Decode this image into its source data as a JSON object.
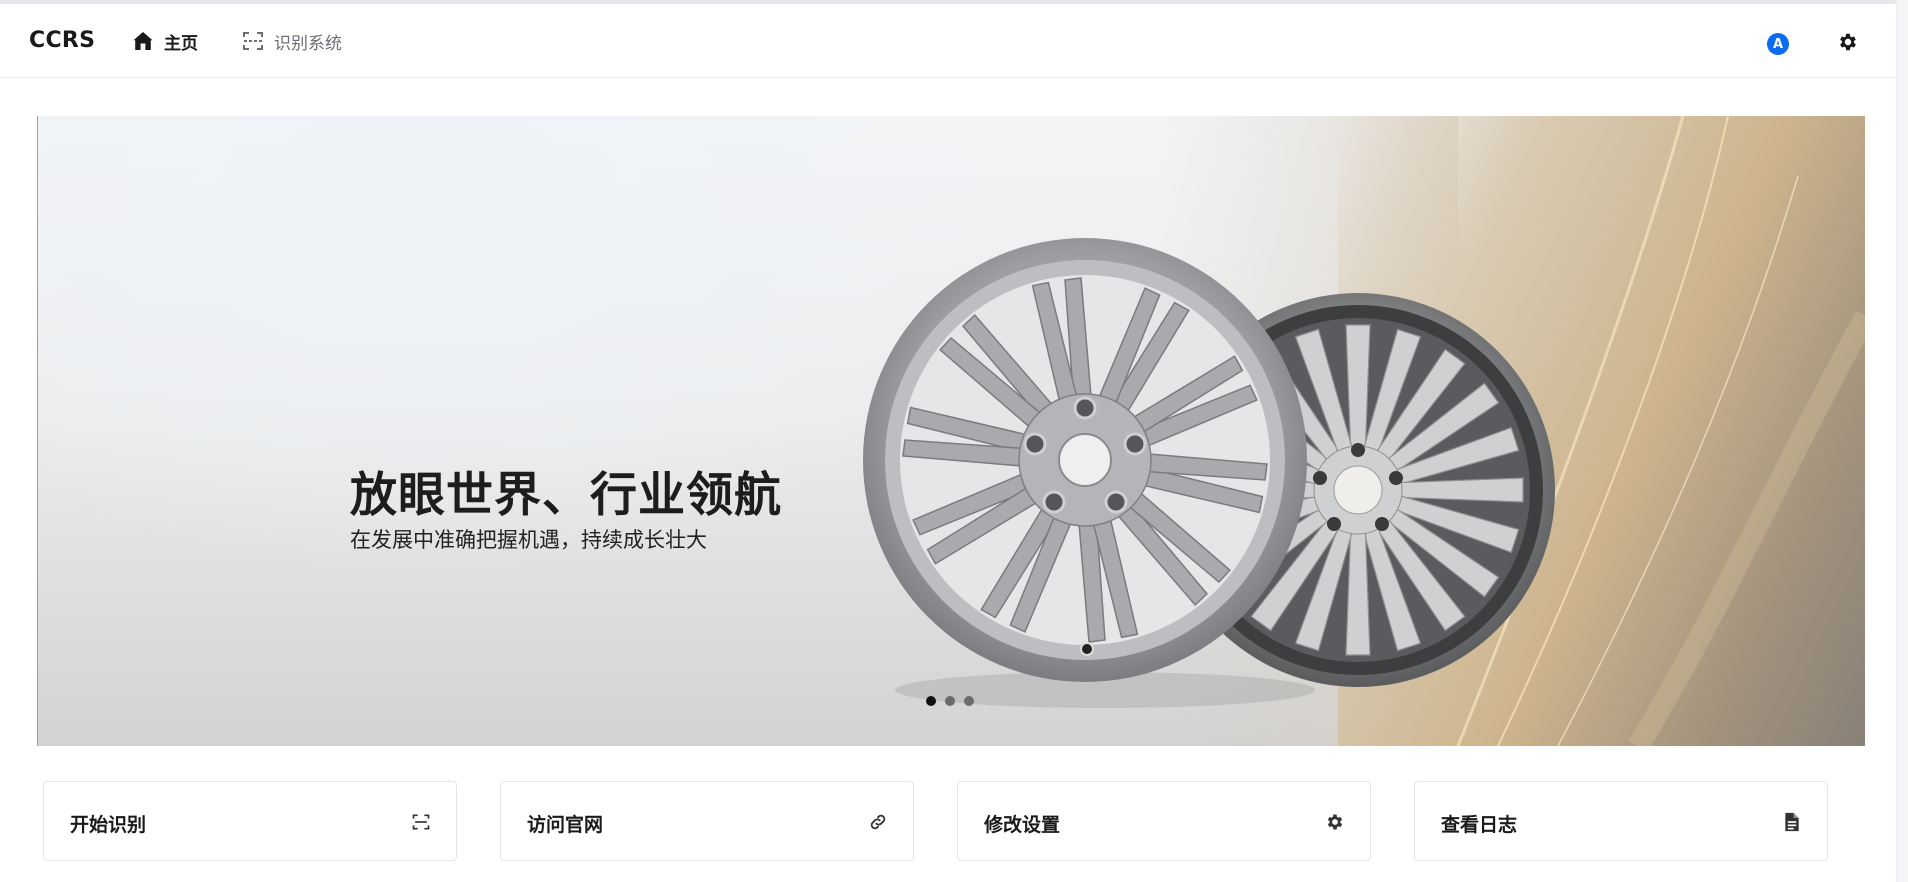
{
  "app": {
    "brand": "CCRS"
  },
  "nav": {
    "items": [
      {
        "label": "主页",
        "icon": "home-icon",
        "active": true
      },
      {
        "label": "识别系统",
        "icon": "scan-icon",
        "active": false
      }
    ]
  },
  "header": {
    "avatar_letter": "A",
    "settings_icon": "gear-icon"
  },
  "banner": {
    "headline": "放眼世界、行业领航",
    "subline": "在发展中准确把握机遇，持续成长壮大",
    "slides": 3,
    "active_slide": 1
  },
  "cards": [
    {
      "label": "开始识别",
      "icon": "scan-icon"
    },
    {
      "label": "访问官网",
      "icon": "link-icon"
    },
    {
      "label": "修改设置",
      "icon": "gear-icon"
    },
    {
      "label": "查看日志",
      "icon": "document-icon"
    }
  ],
  "colors": {
    "accent": "#0a6cf0",
    "text": "#1a1a1a",
    "muted": "#6b6f75"
  }
}
